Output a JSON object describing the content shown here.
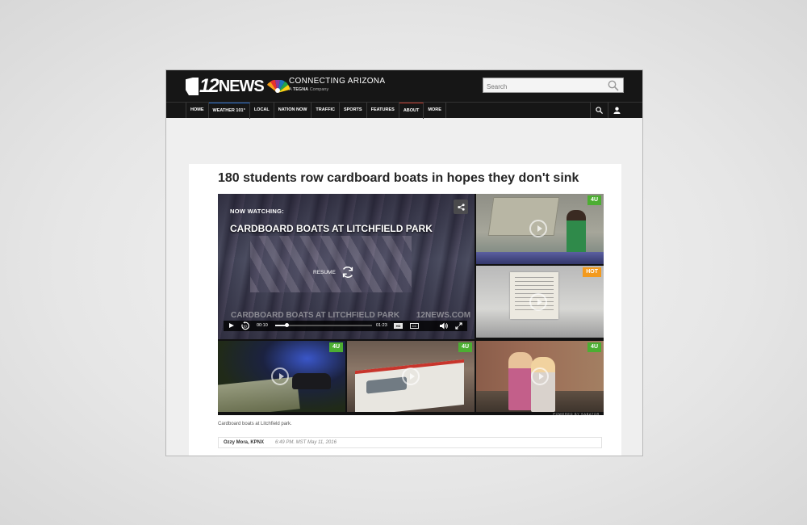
{
  "header": {
    "logo_number": "12",
    "logo_news": "NEWS",
    "tagline": "CONNECTING ARIZONA",
    "sub_tagline_prefix": "A",
    "sub_tagline_brand": "TEGNA",
    "sub_tagline_suffix": "Company",
    "search": {
      "placeholder": "Search",
      "value": ""
    }
  },
  "nav": {
    "items": [
      "HOME",
      "WEATHER 101°",
      "LOCAL",
      "NATION NOW",
      "TRAFFIC",
      "SPORTS",
      "FEATURES",
      "ABOUT",
      "MORE"
    ],
    "icons": [
      "search-icon",
      "user-icon"
    ]
  },
  "article": {
    "headline": "180 students row cardboard boats in hopes they don't sink",
    "caption": "Cardboard boats at Litchfield park.",
    "author": "Ozzy Mora, KPNX",
    "timestamp": "6:49 PM. MST May 11, 2016"
  },
  "player": {
    "now_watching": "NOW WATCHING:",
    "video_title": "CARDBOARD BOATS AT LITCHFIELD PARK",
    "resume_label": "RESUME",
    "lower_third": "CARDBOARD BOATS AT LITCHFIELD PARK",
    "lower_third_brand": "12NEWS.COM",
    "current_time": "00:10",
    "total_time": "01:23",
    "progress": 0.12,
    "hd_label": "HD",
    "cc_label": "CC",
    "powered_by": "POWERED BY SABATOR",
    "thumbnails": [
      {
        "badge": "4U",
        "badge_color": "#4cae32"
      },
      {
        "badge": "HOT",
        "badge_color": "#f39a1e"
      },
      {
        "badge": "4U",
        "badge_color": "#4cae32"
      },
      {
        "badge": "4U",
        "badge_color": "#4cae32"
      },
      {
        "badge": "4U",
        "badge_color": "#4cae32"
      }
    ]
  },
  "colors": {
    "header_bg": "#161616",
    "badge_green": "#4cae32",
    "badge_orange": "#f39a1e"
  }
}
